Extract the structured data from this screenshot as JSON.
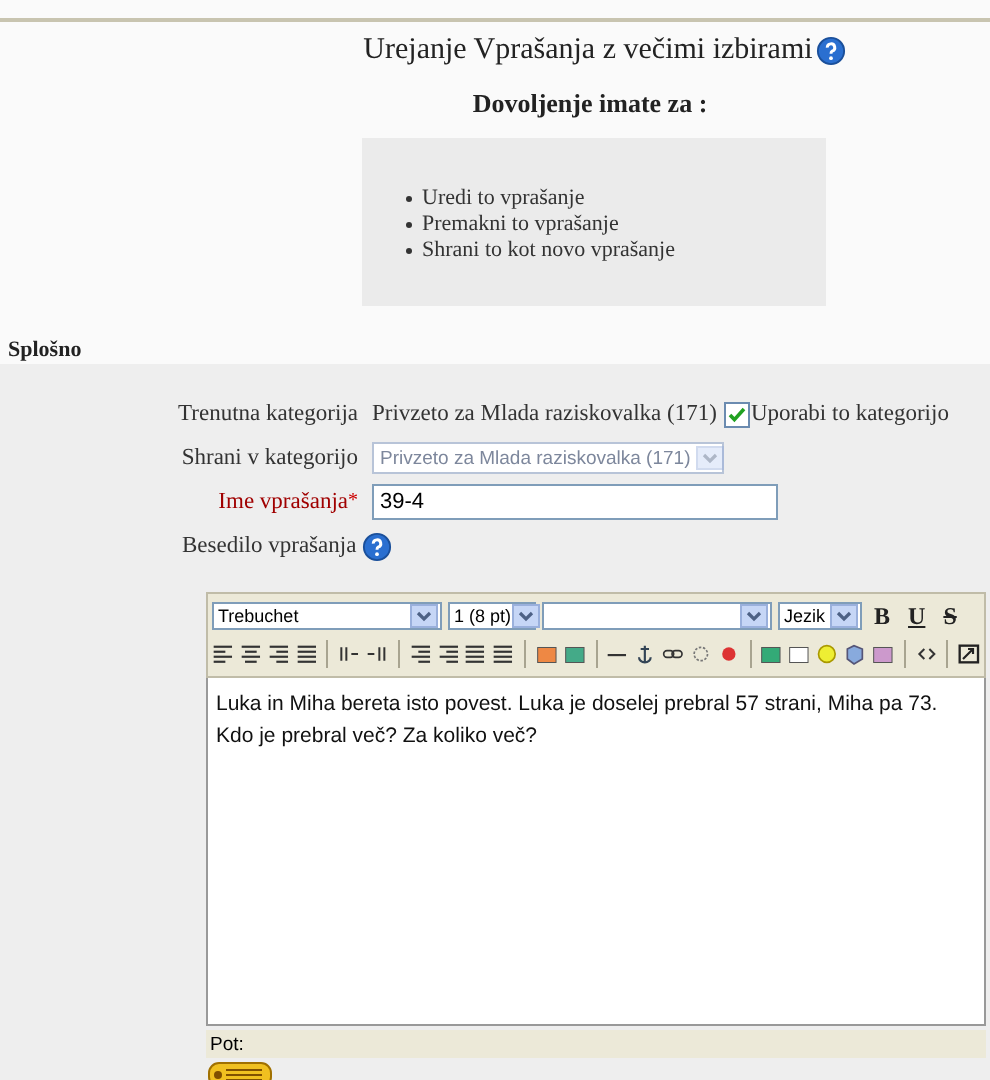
{
  "heading": "Urejanje Vprašanja z večimi izbirami",
  "permissions": {
    "title": "Dovoljenje imate za :",
    "items": [
      "Uredi to vprašanje",
      "Premakni to vprašanje",
      "Shrani to kot novo vprašanje"
    ]
  },
  "section": {
    "title": "Splošno"
  },
  "fields": [
    {
      "kind": "static",
      "label": "Trenutna kategorija",
      "value": "Privzeto za Mlada raziskovalka (171)",
      "checkbox": {
        "label": "Uporabi to kategorijo",
        "checked": true
      }
    },
    {
      "kind": "select",
      "label": "Shrani v kategorijo",
      "value": "Privzeto za Mlada raziskovalka (171)",
      "disabled": true
    },
    {
      "kind": "input",
      "label": "Ime vprašanja",
      "required_mark": "*",
      "value": "39-4"
    },
    {
      "kind": "editor",
      "label": "Besedilo vprašanja"
    }
  ],
  "editor": {
    "font_select": "Trebuchet",
    "size_select": "1 (8 pt)",
    "language_select": "Jezik",
    "format_buttons": [
      "B",
      "U",
      "S"
    ],
    "content": "Luka in Miha bereta isto povest. Luka je doselej prebral 57 strani, Miha pa 73. Kdo je prebral več? Za koliko več?",
    "path_label": "Pot:"
  }
}
